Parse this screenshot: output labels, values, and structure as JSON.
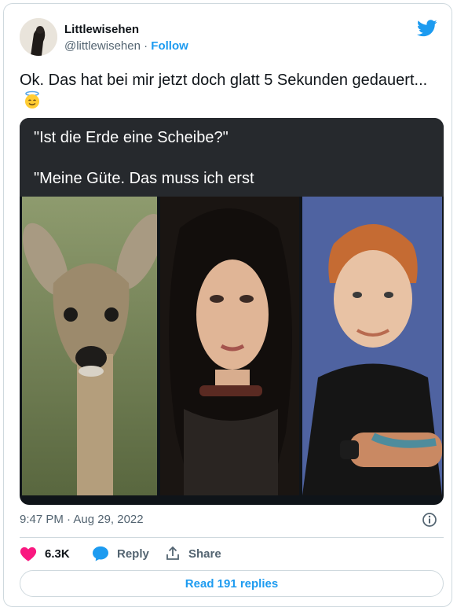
{
  "author": {
    "name": "Littlewisehen",
    "handle": "@littlewisehen",
    "separator": " · ",
    "follow_label": "Follow"
  },
  "tweet": {
    "text": "Ok.  Das hat bei mir jetzt doch glatt 5 Sekunden gedauert...",
    "emoji": "smiling-face-with-halo-icon"
  },
  "media": {
    "caption_line1": "\"Ist die Erde eine Scheibe?\"",
    "caption_line2": "\"Meine Güte. Das muss ich erst"
  },
  "meta": {
    "timestamp": "9:47 PM · Aug 29, 2022"
  },
  "actions": {
    "like_count": "6.3K",
    "reply_label": "Reply",
    "share_label": "Share"
  },
  "read_replies_label": "Read 191 replies",
  "colors": {
    "brand": "#1d9bf0",
    "like": "#f91880",
    "text": "#0f1419",
    "muted": "#536471"
  }
}
